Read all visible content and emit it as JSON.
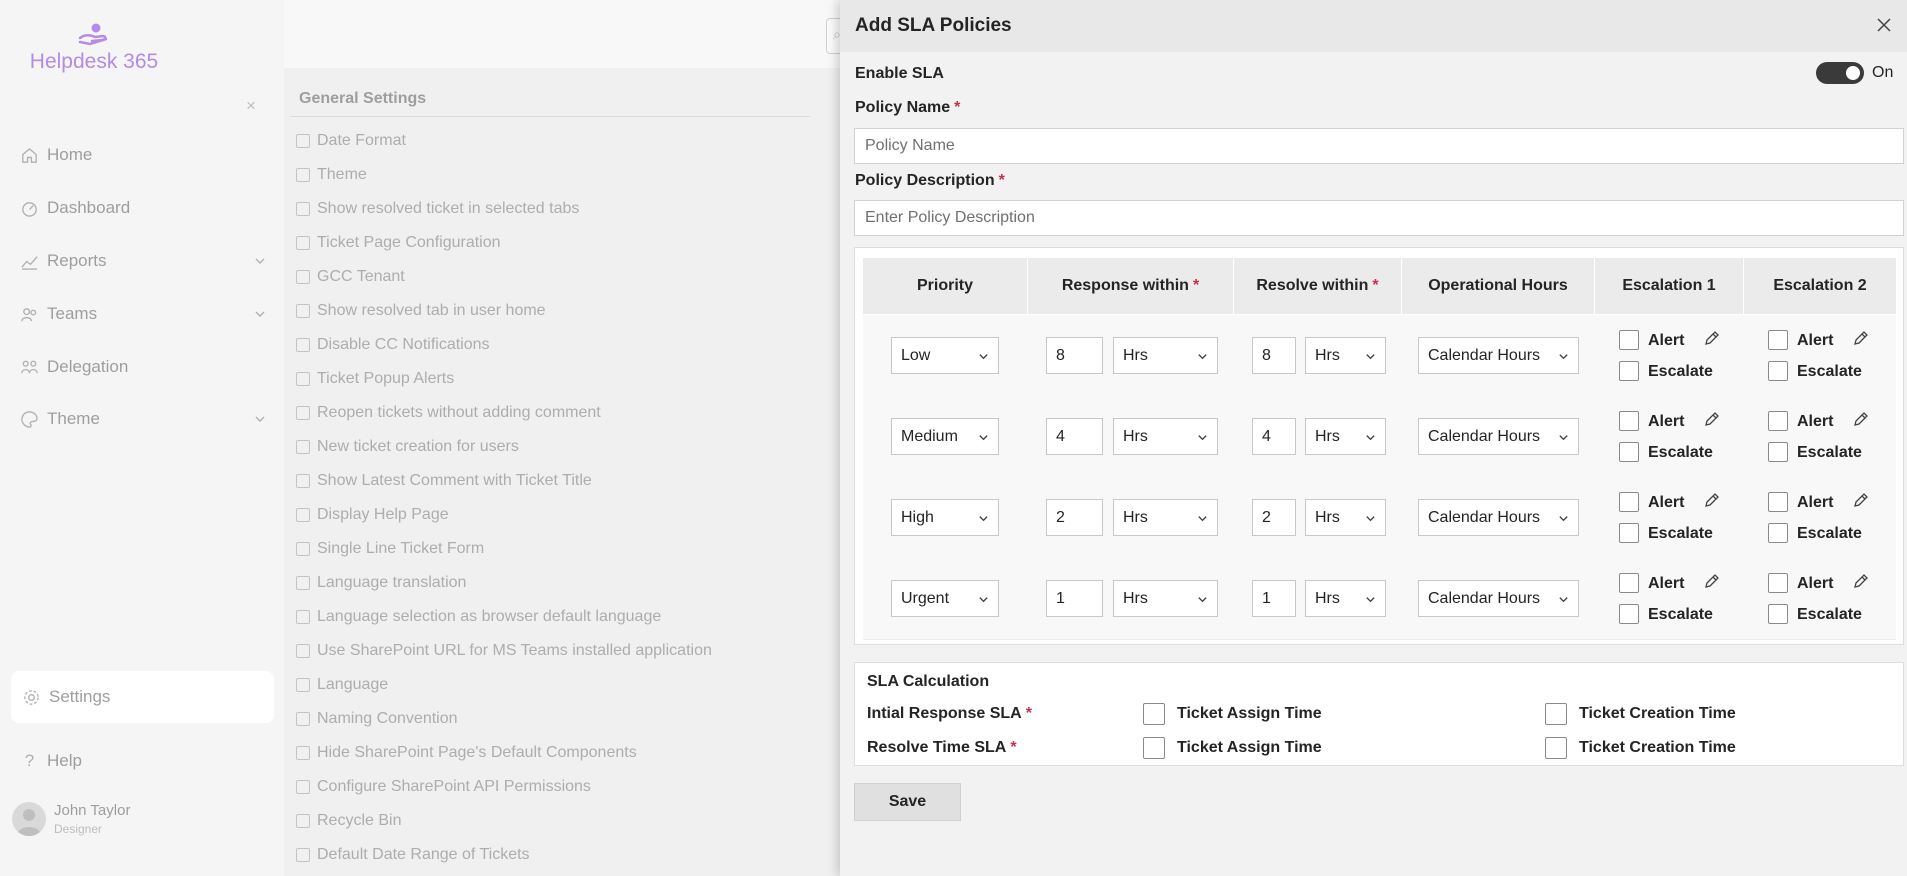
{
  "app": {
    "name": "Helpdesk 365",
    "colors": {
      "brand": "#b58be6",
      "toggle": "#3a3a3a",
      "required": "#c4314b"
    }
  },
  "sidebar": {
    "items": [
      {
        "label": "Home",
        "icon": "home-icon"
      },
      {
        "label": "Dashboard",
        "icon": "dashboard-icon"
      },
      {
        "label": "Reports",
        "icon": "reports-icon",
        "expandable": true
      },
      {
        "label": "Teams",
        "icon": "teams-icon",
        "expandable": true
      },
      {
        "label": "Delegation",
        "icon": "delegation-icon"
      },
      {
        "label": "Theme",
        "icon": "theme-icon",
        "expandable": true
      }
    ],
    "settings": "Settings",
    "help": "Help",
    "user": {
      "name": "John Taylor",
      "role": "Designer"
    }
  },
  "general_settings": {
    "title": "General Settings",
    "items": [
      "Date Format",
      "Theme",
      "Show resolved ticket in selected tabs",
      "Ticket Page Configuration",
      "GCC Tenant",
      "Show resolved tab in user home",
      "Disable CC Notifications",
      "Ticket Popup Alerts",
      "Reopen tickets without adding comment",
      "New ticket creation for users",
      "Show Latest Comment with Ticket Title",
      "Display Help Page",
      "Single Line Ticket Form",
      "Language translation",
      "Language selection as browser default language",
      "Use SharePoint URL for MS Teams installed application",
      "Language",
      "Naming Convention",
      "Hide SharePoint Page's Default Components",
      "Configure SharePoint API Permissions",
      "Recycle Bin",
      "Default Date Range of Tickets"
    ]
  },
  "panel": {
    "title": "Add SLA Policies",
    "enable_sla": {
      "label": "Enable SLA",
      "state": "On"
    },
    "policy_name": {
      "label": "Policy Name",
      "required": "*",
      "placeholder": "Policy Name"
    },
    "policy_description": {
      "label": "Policy Description",
      "required": "*",
      "placeholder": "Enter Policy Description"
    },
    "table": {
      "headers": {
        "priority": "Priority",
        "response": "Response within",
        "resolve": "Resolve within",
        "operational": "Operational Hours",
        "esc1": "Escalation 1",
        "esc2": "Escalation 2",
        "required": "*"
      },
      "rows": [
        {
          "priority": "Low",
          "response_value": "8",
          "response_unit": "Hrs",
          "resolve_value": "8",
          "resolve_unit": "Hrs",
          "hours": "Calendar Hours",
          "alert": "Alert",
          "escalate": "Escalate"
        },
        {
          "priority": "Medium",
          "response_value": "4",
          "response_unit": "Hrs",
          "resolve_value": "4",
          "resolve_unit": "Hrs",
          "hours": "Calendar Hours",
          "alert": "Alert",
          "escalate": "Escalate"
        },
        {
          "priority": "High",
          "response_value": "2",
          "response_unit": "Hrs",
          "resolve_value": "2",
          "resolve_unit": "Hrs",
          "hours": "Calendar Hours",
          "alert": "Alert",
          "escalate": "Escalate"
        },
        {
          "priority": "Urgent",
          "response_value": "1",
          "response_unit": "Hrs",
          "resolve_value": "1",
          "resolve_unit": "Hrs",
          "hours": "Calendar Hours",
          "alert": "Alert",
          "escalate": "Escalate"
        }
      ]
    },
    "sla_calculation": {
      "title": "SLA Calculation",
      "rows": [
        {
          "label": "Intial Response SLA",
          "required": "*",
          "option1": "Ticket Assign Time",
          "option2": "Ticket Creation Time"
        },
        {
          "label": "Resolve Time SLA",
          "required": "*",
          "option1": "Ticket Assign Time",
          "option2": "Ticket Creation Time"
        }
      ]
    },
    "save_label": "Save"
  }
}
